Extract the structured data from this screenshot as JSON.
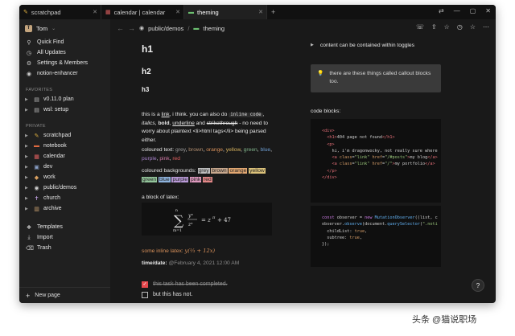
{
  "tabs": [
    {
      "label": "scratchpad",
      "icon": "✎"
    },
    {
      "label": "calendar | calendar",
      "icon": "▦"
    },
    {
      "label": "theming",
      "icon": "▬"
    }
  ],
  "newtab": "+",
  "window_controls": [
    "⇄",
    "—",
    "▢",
    "✕"
  ],
  "sidebar": {
    "workspace": "Tom",
    "workspace_initial": "T",
    "top_items": [
      {
        "label": "Quick Find",
        "icon": "⚲"
      },
      {
        "label": "All Updates",
        "icon": "◷"
      },
      {
        "label": "Settings & Members",
        "icon": "⚙"
      },
      {
        "label": "notion-enhancer",
        "icon": "◉"
      }
    ],
    "favorites_header": "FAVORITES",
    "favorites": [
      {
        "label": "v0.11.0 plan",
        "icon": "▤"
      },
      {
        "label": "wsl: setup",
        "icon": "▤"
      }
    ],
    "private_header": "PRIVATE",
    "private": [
      {
        "label": "scratchpad",
        "icon": "✎"
      },
      {
        "label": "notebook",
        "icon": "▬"
      },
      {
        "label": "calendar",
        "icon": "▦"
      },
      {
        "label": "dev",
        "icon": "▣"
      },
      {
        "label": "work",
        "icon": "◆"
      },
      {
        "label": "public/demos",
        "icon": "◉"
      },
      {
        "label": "church",
        "icon": "✝"
      },
      {
        "label": "archive",
        "icon": "▥"
      }
    ],
    "bottom_items": [
      {
        "label": "Templates",
        "icon": "❖"
      },
      {
        "label": "Import",
        "icon": "⤓"
      },
      {
        "label": "Trash",
        "icon": "⌫"
      }
    ],
    "new_page": "New page"
  },
  "breadcrumb": {
    "parent": "public/demos",
    "sep": "/",
    "current": "theming"
  },
  "topbar_icons": [
    "☏",
    "⇪",
    "☆",
    "◷",
    "☆",
    "⋯"
  ],
  "doc": {
    "h1": "h1",
    "h2": "h2",
    "h3": "h3",
    "p1": {
      "a": "this is a ",
      "link": "link",
      "b": ", i think. you can also do ",
      "code": "inline code",
      "c": ",",
      "italics": "italics",
      "d": ", ",
      "bold": "bold",
      "e": ", ",
      "underline": "underline",
      "f": " and ",
      "strike": "strikethrough",
      "g": " - no need to worry about plaintext <li>html tags</li> being parsed either."
    },
    "colored_text_label": "coloured text: ",
    "colored_text": [
      {
        "t": "grey",
        "c": "#9b9b9b"
      },
      {
        "t": ", ",
        "c": "#e8e8e8"
      },
      {
        "t": "brown",
        "c": "#b08d6f"
      },
      {
        "t": ", ",
        "c": "#e8e8e8"
      },
      {
        "t": "orange",
        "c": "#d9915b"
      },
      {
        "t": ", ",
        "c": "#e8e8e8"
      },
      {
        "t": "yellow",
        "c": "#d4b15d"
      },
      {
        "t": ", ",
        "c": "#e8e8e8"
      },
      {
        "t": "green",
        "c": "#7fb38a"
      },
      {
        "t": ", ",
        "c": "#e8e8e8"
      },
      {
        "t": "blue",
        "c": "#6e9fd4"
      },
      {
        "t": ", ",
        "c": "#e8e8e8"
      },
      {
        "t": "purple",
        "c": "#a882cc"
      },
      {
        "t": ", ",
        "c": "#e8e8e8"
      },
      {
        "t": "pink",
        "c": "#d078a6"
      },
      {
        "t": ", ",
        "c": "#e8e8e8"
      },
      {
        "t": "red",
        "c": "#e06060"
      }
    ],
    "colored_bg_label": "coloured backgrounds: ",
    "colored_bg": [
      {
        "t": "grey",
        "c": "#bdbdbd"
      },
      {
        "t": "brown",
        "c": "#c8a88e"
      },
      {
        "t": "orange",
        "c": "#e3a872"
      },
      {
        "t": "yellow",
        "c": "#dcc27a"
      },
      {
        "t": "green",
        "c": "#93c59b"
      },
      {
        "t": "blue",
        "c": "#8eb3dd"
      },
      {
        "t": "purple",
        "c": "#b99ad8"
      },
      {
        "t": "pink",
        "c": "#dd98bd"
      },
      {
        "t": "red",
        "c": "#e38888"
      }
    ],
    "latex_label": "a block of latex:",
    "latex_formula": "∑ yⁿ/zⁿ = z^π + 47",
    "inline_latex_label": "some inline latex: ",
    "inline_latex": "y(⅓ + 12x)",
    "time_label": "time/date: ",
    "time_value": "@February 4, 2021 12:00 AM",
    "todos": [
      {
        "label": "this task has been completed.",
        "done": true
      },
      {
        "label": "but this has not.",
        "done": false
      }
    ]
  },
  "right": {
    "toggle": "content can be contained within toggles",
    "callout": "there are these things called callout blocks too.",
    "codeblocks_label": "code blocks:",
    "code1": "<div>\n  <h1>404 page not found</h1>\n  <p>\n    hi, i'm dragonwocky, not really sure where\n    <a class=\"link\" href=\"/#posts\">my blog</a>\n    <a class=\"link\" href=\"/\">my portfolio</a>\n  </p>\n</div>",
    "code2": "const observer = new MutationObserver((list, c\nobserver.observe(document.querySelector(\".noti\n  childList: true,\n  subtree: true,\n});"
  },
  "help": "?",
  "watermark": "头条 @猫说职场"
}
